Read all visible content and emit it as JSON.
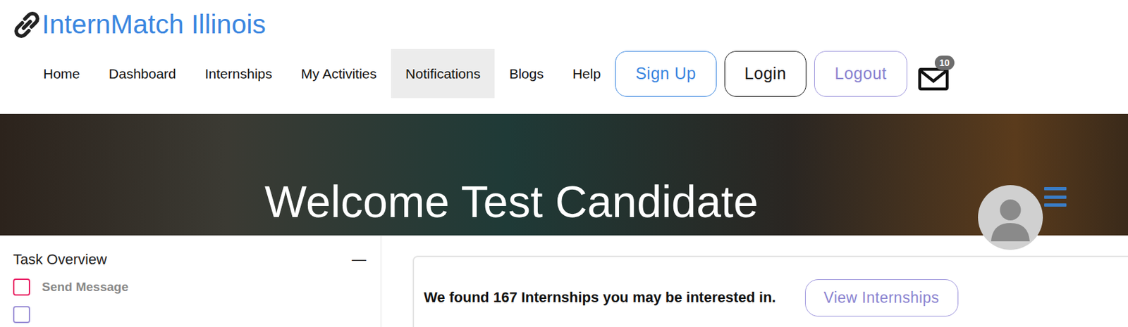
{
  "logo": {
    "text": "InternMatch Illinois"
  },
  "nav": [
    {
      "label": "Home",
      "selected": false
    },
    {
      "label": "Dashboard",
      "selected": false
    },
    {
      "label": "Internships",
      "selected": false
    },
    {
      "label": "My Activities",
      "selected": false
    },
    {
      "label": "Notifications",
      "selected": true
    },
    {
      "label": "Blogs",
      "selected": false
    },
    {
      "label": "Help",
      "selected": false
    }
  ],
  "auth_buttons": [
    {
      "label": "Sign Up",
      "kind": "primary"
    },
    {
      "label": "Login",
      "kind": "default"
    },
    {
      "label": "Logout",
      "kind": "muted"
    }
  ],
  "mail": {
    "badge": "10"
  },
  "banner": {
    "title": "Welcome Test Candidate"
  },
  "task_overview": {
    "title": "Task Overview",
    "collapse": "—",
    "tasks": [
      {
        "label": "Send Message",
        "checked": false,
        "color": "#e91e63"
      },
      {
        "checked": false,
        "color": "#9b8fd6"
      }
    ]
  },
  "recommendation": {
    "text": "We found 167 Internships you may be interested in.",
    "button": "View Internships"
  }
}
